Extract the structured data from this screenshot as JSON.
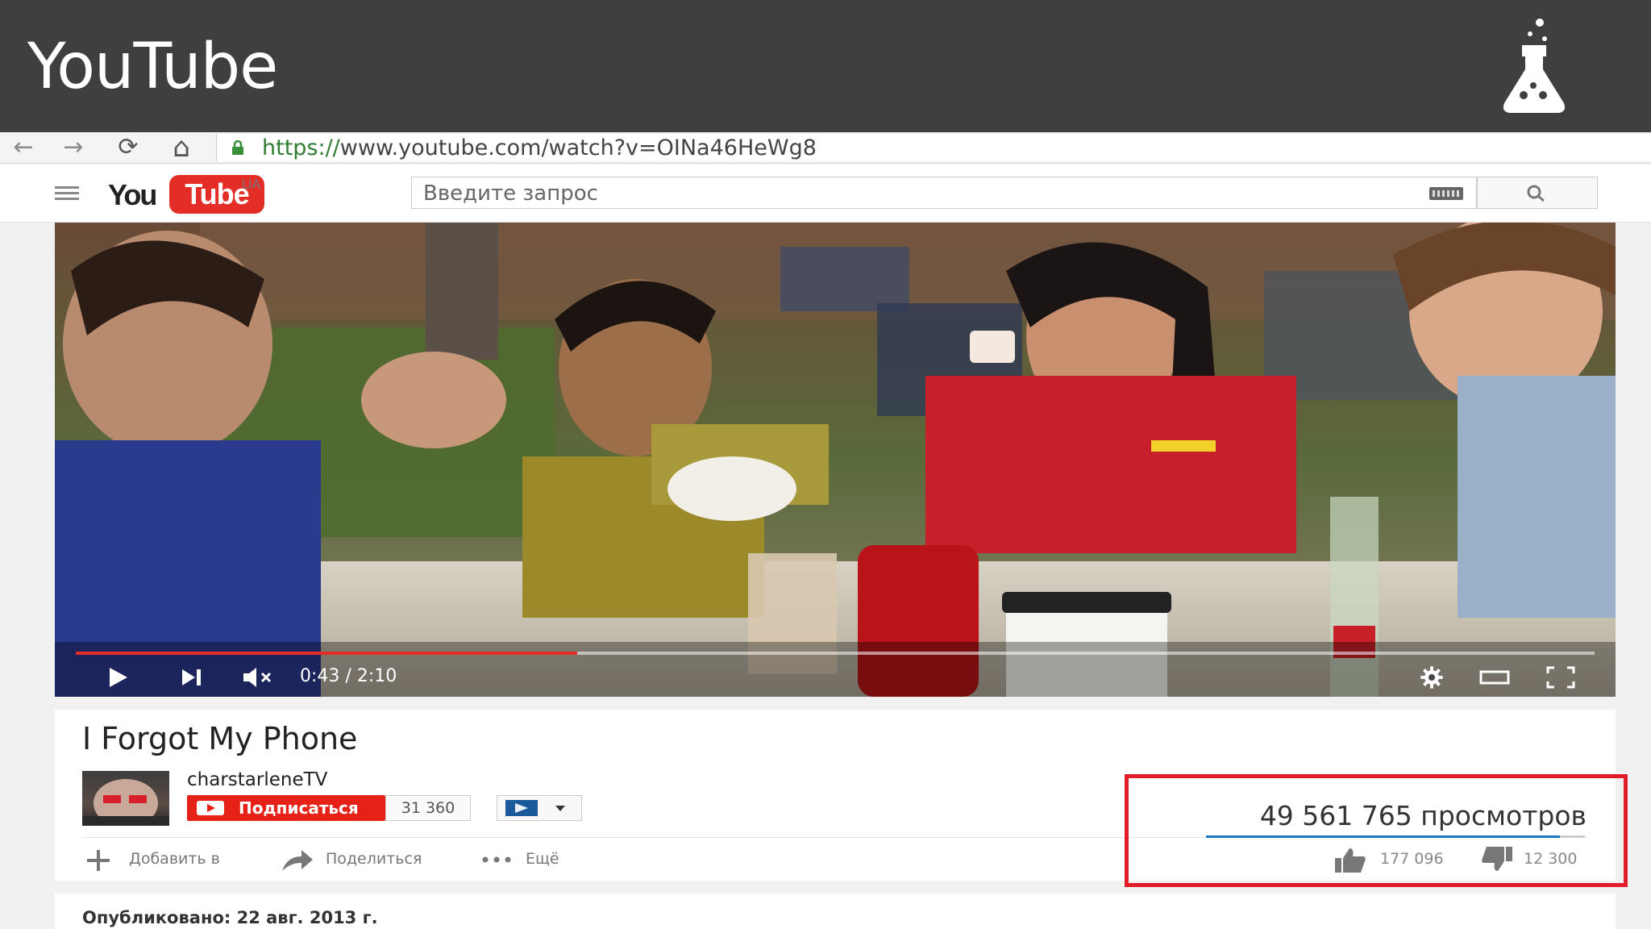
{
  "slide": {
    "title": "YouTube",
    "icon": "flask-icon"
  },
  "browser": {
    "url_scheme": "https://",
    "url_rest": "www.youtube.com/watch?v=OINa46HeWg8",
    "back": "←",
    "forward": "→",
    "reload": "⟳",
    "home": "⌂"
  },
  "masthead": {
    "logo_you": "You",
    "logo_tube": "Tube",
    "region": "UA",
    "search_placeholder": "Введите запрос"
  },
  "player": {
    "time": "0:43 / 2:10",
    "progress": 0.33
  },
  "video": {
    "title": "I Forgot My Phone",
    "channel": "charstarleneTV",
    "subscribe_label": "Подписаться",
    "subscriber_count": "31 360",
    "actions": {
      "add": "Добавить в",
      "share": "Поделиться",
      "more": "Ещё"
    },
    "views": "49 561 765 просмотров",
    "likes": "177 096",
    "dislikes": "12 300",
    "like_ratio": 0.935
  },
  "description": {
    "published": "Опубликовано: 22 авг. 2013 г."
  },
  "colors": {
    "accent": "#e52d27",
    "highlight": "#e11d2a",
    "header": "#3f3f3f",
    "like_bar": "#167ac6"
  }
}
